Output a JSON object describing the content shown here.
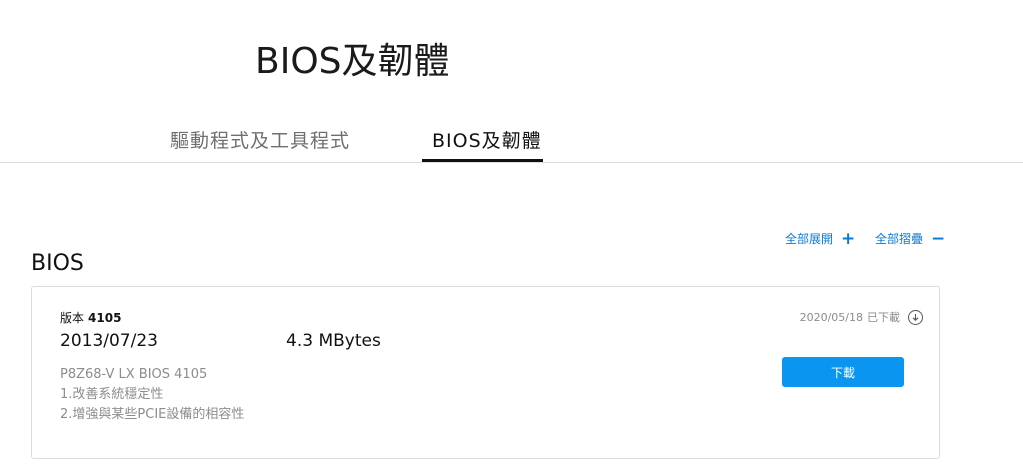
{
  "page": {
    "title": "BIOS及韌體"
  },
  "tabs": [
    {
      "label": "驅動程式及工具程式",
      "active": false
    },
    {
      "label": "BIOS及韌體",
      "active": true
    }
  ],
  "controls": {
    "expand_all": "全部展開",
    "expand_symbol": "+",
    "collapse_all": "全部摺疊",
    "collapse_symbol": "−"
  },
  "section": {
    "title": "BIOS"
  },
  "bios_item": {
    "version_label": "版本",
    "version": "4105",
    "date": "2013/07/23",
    "size": "4.3 MBytes",
    "description": [
      "P8Z68-V LX BIOS 4105",
      "1.改善系統穩定性",
      "2.增強與某些PCIE設備的相容性"
    ],
    "downloaded_date": "2020/05/18",
    "downloaded_label": "已下載",
    "download_button": "下載",
    "icon": "download-circle-icon"
  },
  "colors": {
    "accent": "#0a7ad8",
    "button": "#0a95f0",
    "muted_text": "#8c8c8c",
    "border": "#dcdcdc"
  }
}
